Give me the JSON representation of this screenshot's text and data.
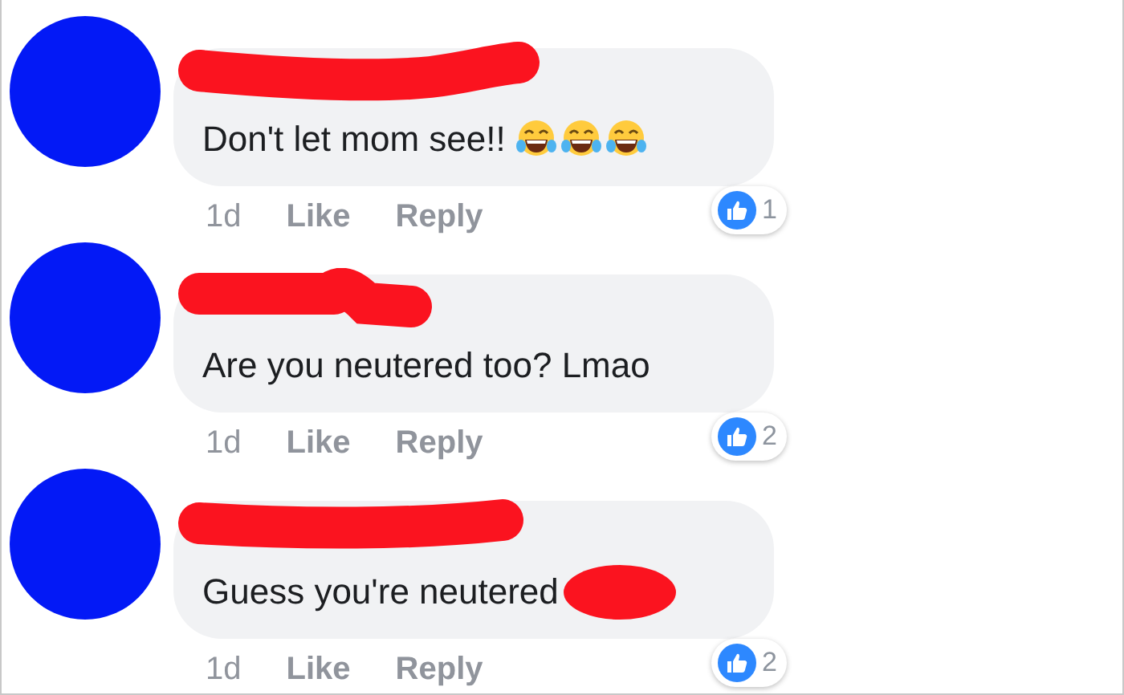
{
  "comments": [
    {
      "text": "Don't let mom see!!",
      "trailing": [
        {
          "kind": "emoji"
        },
        {
          "kind": "emoji"
        },
        {
          "kind": "emoji"
        }
      ],
      "time": "1d",
      "like": "Like",
      "reply": "Reply",
      "reactions": "1"
    },
    {
      "text": "Are you neutered too? Lmao",
      "time": "1d",
      "like": "Like",
      "reply": "Reply",
      "reactions": "2"
    },
    {
      "text": "Guess you're neutered",
      "trailing": [
        {
          "kind": "redaction"
        }
      ],
      "time": "1d",
      "like": "Like",
      "reply": "Reply",
      "reactions": "2"
    }
  ]
}
